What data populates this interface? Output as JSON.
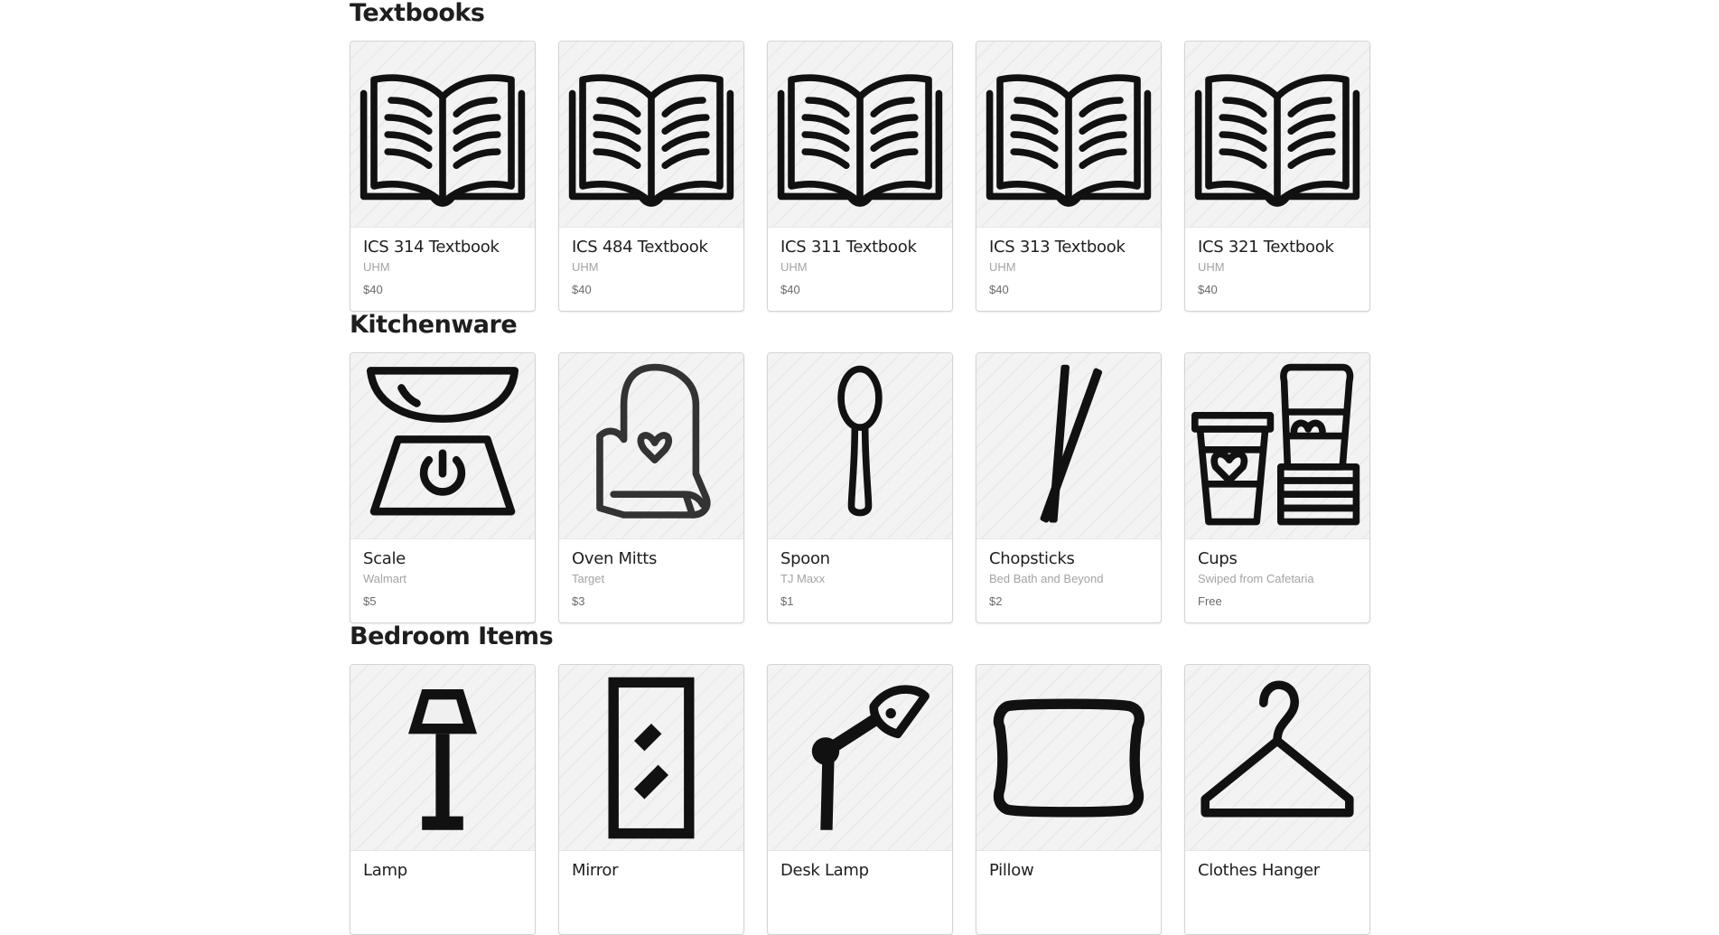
{
  "sections": [
    {
      "title": "Textbooks",
      "items": [
        {
          "name": "ICS 314 Textbook",
          "source": "UHM",
          "price": "$40",
          "icon": "open-book-icon"
        },
        {
          "name": "ICS 484 Textbook",
          "source": "UHM",
          "price": "$40",
          "icon": "open-book-icon"
        },
        {
          "name": "ICS 311 Textbook",
          "source": "UHM",
          "price": "$40",
          "icon": "open-book-icon"
        },
        {
          "name": "ICS 313 Textbook",
          "source": "UHM",
          "price": "$40",
          "icon": "open-book-icon"
        },
        {
          "name": "ICS 321 Textbook",
          "source": "UHM",
          "price": "$40",
          "icon": "open-book-icon"
        }
      ]
    },
    {
      "title": "Kitchenware",
      "items": [
        {
          "name": "Scale",
          "source": "Walmart",
          "price": "$5",
          "icon": "scale-icon"
        },
        {
          "name": "Oven Mitts",
          "source": "Target",
          "price": "$3",
          "icon": "oven-mitt-icon"
        },
        {
          "name": "Spoon",
          "source": "TJ Maxx",
          "price": "$1",
          "icon": "spoon-icon"
        },
        {
          "name": "Chopsticks",
          "source": "Bed Bath and Beyond",
          "price": "$2",
          "icon": "chopsticks-icon"
        },
        {
          "name": "Cups",
          "source": "Swiped from Cafetaria",
          "price": "Free",
          "icon": "cups-icon"
        }
      ]
    },
    {
      "title": "Bedroom Items",
      "items": [
        {
          "name": "Lamp",
          "icon": "floor-lamp-icon"
        },
        {
          "name": "Mirror",
          "icon": "mirror-icon"
        },
        {
          "name": "Desk Lamp",
          "icon": "desk-lamp-icon"
        },
        {
          "name": "Pillow",
          "icon": "pillow-icon"
        },
        {
          "name": "Clothes Hanger",
          "icon": "clothes-hanger-icon"
        }
      ]
    }
  ]
}
